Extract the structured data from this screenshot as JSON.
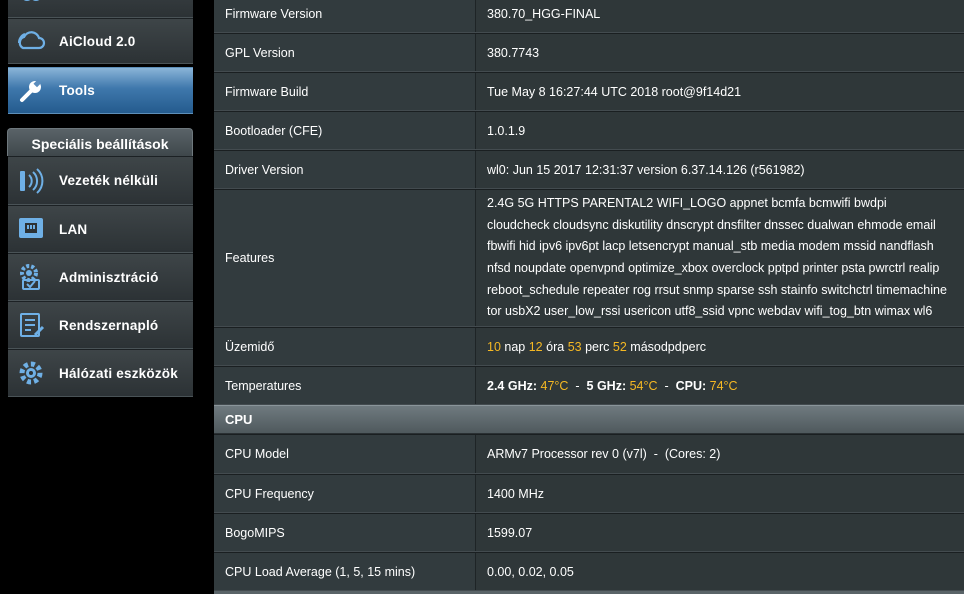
{
  "sidebar": {
    "top_items": [
      {
        "label": "AiCloud 2.0",
        "icon": "cloud-icon"
      },
      {
        "label": "Tools",
        "icon": "wrench-icon"
      }
    ],
    "section_title": "Speciális beállítások",
    "advanced_items": [
      {
        "label": "Vezeték nélküli",
        "icon": "wifi-icon"
      },
      {
        "label": "LAN",
        "icon": "lan-icon"
      },
      {
        "label": "Adminisztráció",
        "icon": "admin-gear-icon"
      },
      {
        "label": "Rendszernapló",
        "icon": "system-log-icon"
      },
      {
        "label": "Hálózati eszközök",
        "icon": "network-tools-icon"
      }
    ]
  },
  "system": {
    "firmware_version": {
      "label": "Firmware Version",
      "value": "380.70_HGG-FINAL"
    },
    "gpl_version": {
      "label": "GPL Version",
      "value": "380.7743"
    },
    "firmware_build": {
      "label": "Firmware Build",
      "value": "Tue May 8 16:27:44 UTC 2018 root@9f14d21"
    },
    "bootloader": {
      "label": "Bootloader (CFE)",
      "value": "1.0.1.9"
    },
    "driver_version": {
      "label": "Driver Version",
      "value": "wl0: Jun 15 2017 12:31:37 version 6.37.14.126 (r561982)"
    },
    "features": {
      "label": "Features",
      "value": "2.4G 5G HTTPS PARENTAL2 WIFI_LOGO appnet bcmfa bcmwifi bwdpi cloudcheck cloudsync diskutility dnscrypt dnsfilter dnssec dualwan ehmode email fbwifi hid ipv6 ipv6pt lacp letsencrypt manual_stb media modem mssid nandflash nfsd noupdate openvpnd optimize_xbox overclock pptpd printer psta pwrctrl realip reboot_schedule repeater rog rrsut snmp sparse ssh stainfo switchctrl timemachine tor usbX2 user_low_rssi usericon utf8_ssid vpnc webdav wifi_tog_btn wimax wl6"
    },
    "uptime": {
      "label": "Üzemidő",
      "days": "10",
      "days_unit": "nap",
      "hours": "12",
      "hours_unit": "óra",
      "minutes": "53",
      "minutes_unit": "perc",
      "seconds": "52",
      "seconds_unit": "másodpdperc"
    },
    "temperatures": {
      "label": "Temperatures",
      "t24_label": "2.4 GHz:",
      "t24_value": "47°C",
      "t5_label": "5 GHz:",
      "t5_value": "54°C",
      "cpu_label": "CPU:",
      "cpu_value": "74°C",
      "separator": "-"
    }
  },
  "cpu_section": {
    "title": "CPU",
    "cpu_model": {
      "label": "CPU Model",
      "value": "ARMv7 Processor rev 0 (v7l)  -  (Cores: 2)"
    },
    "cpu_frequency": {
      "label": "CPU Frequency",
      "value": "1400 MHz"
    },
    "bogomips": {
      "label": "BogoMIPS",
      "value": "1599.07"
    },
    "load_average": {
      "label": "CPU Load Average (1, 5, 15 mins)",
      "value": "0.00, 0.02, 0.05"
    }
  },
  "colors": {
    "highlight": "#f5b823",
    "active_menu": "#3f78ac"
  }
}
